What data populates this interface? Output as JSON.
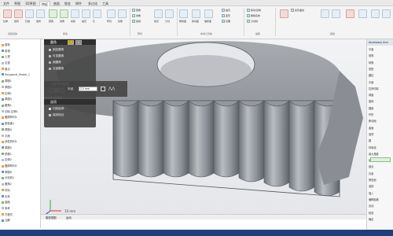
{
  "ribbon": {
    "tabs": [
      "文件",
      "草图",
      "3D草图",
      "特征",
      "曲面",
      "钣金",
      "焊件",
      "多边化",
      "工具"
    ],
    "active_tab": "特征",
    "buttons": [
      "拉伸",
      "旋转",
      "扫描",
      "放样",
      "圆角",
      "倒角",
      "拔模",
      "抽壳",
      "孔",
      "阵列",
      "镜像",
      "组合",
      "分割",
      "删除面",
      "移动面",
      "偏移面"
    ],
    "groups": [
      "创建实体",
      "修改",
      "阵列",
      "参考几何体",
      "编辑",
      "其他"
    ],
    "mini_items": [
      "圆角",
      "倒角",
      "拔模",
      "抽壳",
      "变形",
      "包覆",
      "移动/复制",
      "删除实体",
      "分割线",
      "投影曲线"
    ]
  },
  "left_panel": {
    "items": [
      "基准",
      "前视",
      "上视",
      "右视",
      "原点",
      "Polygonal_Model_1",
      "草图1",
      "草图2",
      "拉伸1",
      "草图3",
      "圆角1",
      "切除-拉伸1",
      "圆周阵列1",
      "基准面1",
      "草图4",
      "平面",
      "线性阵列1",
      "草图5",
      "镜像1",
      "拉伸2",
      "圆周阵列2",
      "草图6",
      "分割线1",
      "圆角2",
      "材料",
      "实体",
      "曲面",
      "参考",
      "方程式",
      "注解"
    ]
  },
  "fillet_dialog": {
    "title": "圆角",
    "options": [
      "固定圆角",
      "可变圆角",
      "面圆角",
      "全部圆角"
    ],
    "section_variable": "自身变径圆角",
    "section_options": "选项",
    "radius_label": "半径",
    "radius_value": "2.5 mm",
    "checkbox_1": "切线延伸",
    "checkbox_2": "保持特征",
    "apply_label": "确定"
  },
  "viewport": {
    "axis_label": "10 mm"
  },
  "right_panel": {
    "title": "Accessory Ann",
    "items": [
      "平面",
      "常规",
      "特殊",
      "类型",
      "圆柱",
      "平面",
      "拉伸切除",
      "球面",
      "旋转",
      "圆锥",
      "环形",
      "移动面",
      "曲面",
      "选项",
      "圆",
      "样条线",
      "最大角度",
      "最小长度",
      "缝合",
      "约束",
      "修复面",
      "选择",
      "插入",
      "偏移距离",
      "自动",
      "检查",
      "确定"
    ]
  },
  "bottom_tabs": [
    "模型视图",
    "运动"
  ],
  "status_text": "",
  "colors": {
    "accent": "#1f3f7a",
    "gear": "#9ea2a8",
    "viewport_bg": "#e8e9ec"
  }
}
